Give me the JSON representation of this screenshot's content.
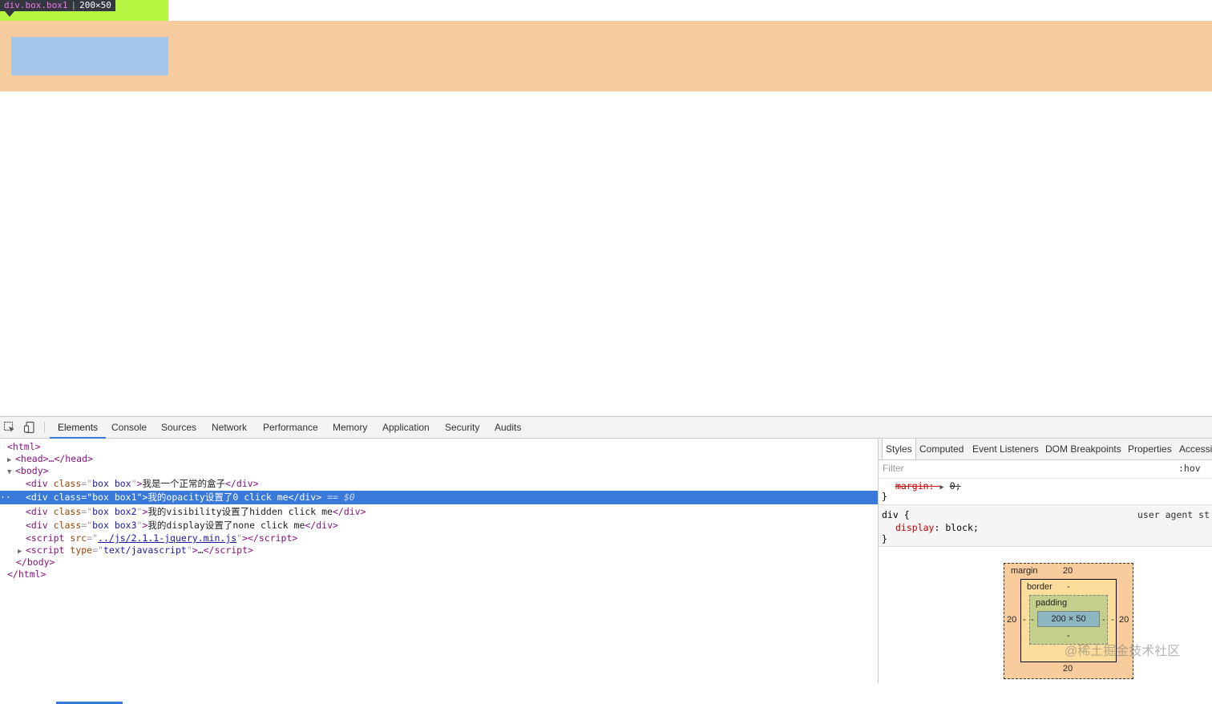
{
  "tooltip": {
    "selector": "div.box.box1",
    "size": "200×50"
  },
  "toolbar": {
    "tabs": [
      "Elements",
      "Console",
      "Sources",
      "Network",
      "Performance",
      "Memory",
      "Application",
      "Security",
      "Audits"
    ],
    "active_tab": "Elements"
  },
  "elements": {
    "lines": [
      "<html>",
      "<head>…</head>",
      "<body>"
    ],
    "html_open": "<html>",
    "head": "<head>…</head>",
    "body_open": "<body>",
    "div1": {
      "class": "box box",
      "text": "我是一个正常的盒子"
    },
    "div2": {
      "class": "box box1",
      "text": "我的opacity设置了0 click me"
    },
    "div3": {
      "class": "box box2",
      "text": "我的visibility设置了hidden click me"
    },
    "div4": {
      "class": "box box3",
      "text": "我的display设置了none click me"
    },
    "script1": {
      "src": "../js/2.1.1-jquery.min.js"
    },
    "script2": {
      "type": "text/javascript"
    },
    "selected_marker": "== $0",
    "body_close": "</body>",
    "html_close": "</html>"
  },
  "sidebar": {
    "tabs": [
      "Styles",
      "Computed",
      "Event Listeners",
      "DOM Breakpoints",
      "Properties",
      "Accessi"
    ],
    "active_tab": "Styles",
    "filter_placeholder": "Filter",
    "hov": ":hov",
    "rule1_prop": "margin",
    "rule1_value": "0",
    "rule2_selector": "div {",
    "rule2_prop": "display",
    "rule2_value": "block",
    "rule2_source": "user agent st",
    "box_model": {
      "margin_label": "margin",
      "margin_top": "20",
      "margin_bottom": "20",
      "margin_left": "20",
      "margin_right": "20",
      "border_label": "border",
      "border_value": "-",
      "padding_label": "padding",
      "padding_value": "-",
      "content": "200 × 50"
    }
  },
  "watermark": "@稀土掘金技术社区",
  "colors": {
    "accent": "#3879d9",
    "margin": "#f6cb9d",
    "content_highlight": "#a5c6ea",
    "tooltip_bg": "#b6f542"
  }
}
